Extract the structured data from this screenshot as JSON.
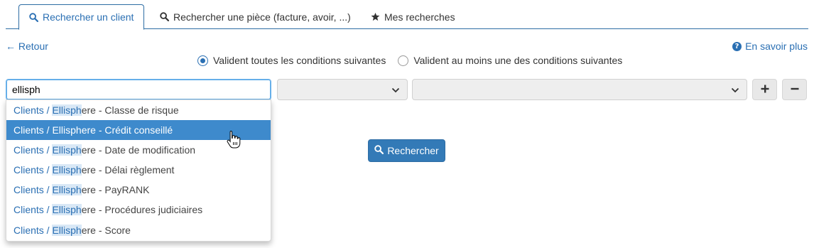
{
  "tabs": [
    {
      "label": "Rechercher un client",
      "icon": "search-icon",
      "active": true
    },
    {
      "label": "Rechercher une pièce (facture, avoir, ...)",
      "icon": "search-icon",
      "active": false
    },
    {
      "label": "Mes recherches",
      "icon": "star-icon",
      "active": false
    }
  ],
  "nav": {
    "back_label": "← Retour",
    "help_label": "En savoir plus",
    "help_icon": "question-circle-icon"
  },
  "conditions": {
    "all_label": "Valident toutes les conditions suivantes",
    "any_label": "Valident au moins une des conditions suivantes",
    "selected": "all"
  },
  "criteria": {
    "field_value": "ellisph",
    "operator_value": "",
    "criterion_value": "",
    "add_icon": "plus-icon",
    "remove_icon": "minus-icon"
  },
  "search_button": {
    "label": "Rechercher",
    "icon": "search-icon"
  },
  "suggestions": {
    "prefix": "Clients / ",
    "match": "Ellisph",
    "items": [
      {
        "rest": "ere - Classe de risque",
        "active": false
      },
      {
        "rest": "ere - Crédit conseillé",
        "active": true
      },
      {
        "rest": "ere - Date de modification",
        "active": false
      },
      {
        "rest": "ere - Délai règlement",
        "active": false
      },
      {
        "rest": "ere - PayRANK",
        "active": false
      },
      {
        "rest": "ere - Procédures judiciaires",
        "active": false
      },
      {
        "rest": "ere - Score",
        "active": false
      }
    ]
  },
  "colors": {
    "accent": "#337ab7",
    "link": "#2a6fb3",
    "highlight_row": "#3e8acc"
  }
}
